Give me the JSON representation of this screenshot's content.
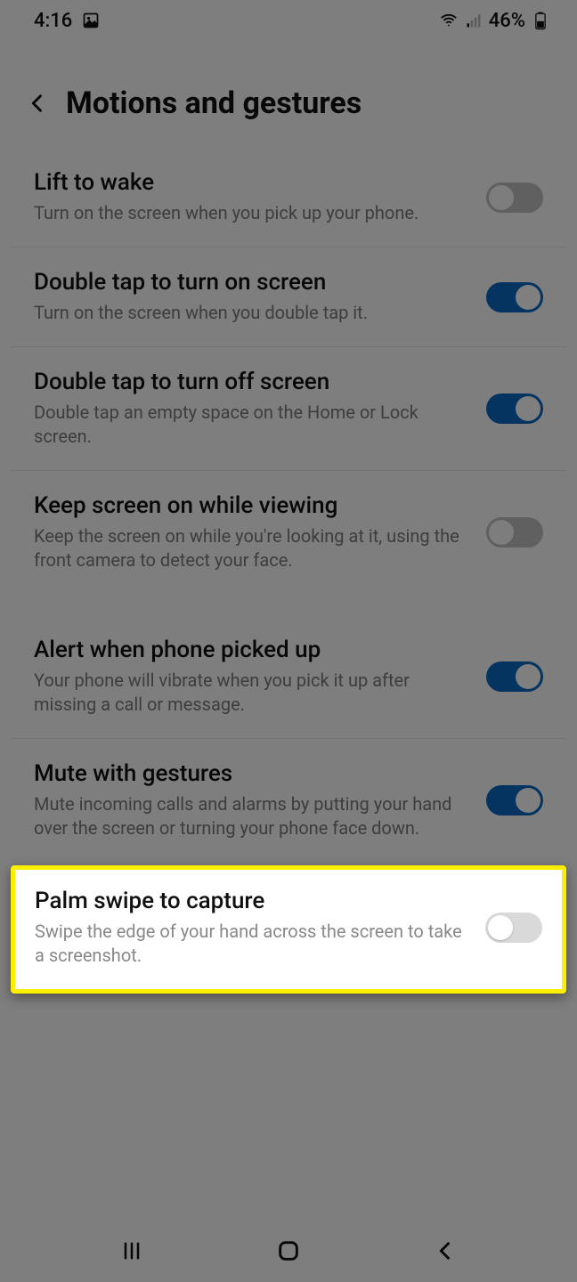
{
  "status_bar": {
    "time": "4:16",
    "battery_text": "46%"
  },
  "header": {
    "title": "Motions and gestures"
  },
  "settings_group1": [
    {
      "title": "Lift to wake",
      "desc": "Turn on the screen when you pick up your phone.",
      "on": false
    },
    {
      "title": "Double tap to turn on screen",
      "desc": "Turn on the screen when you double tap it.",
      "on": true
    },
    {
      "title": "Double tap to turn off screen",
      "desc": "Double tap an empty space on the Home or Lock screen.",
      "on": true
    },
    {
      "title": "Keep screen on while viewing",
      "desc": "Keep the screen on while you're looking at it, using the front camera to detect your face.",
      "on": false
    }
  ],
  "settings_group2": [
    {
      "title": "Alert when phone picked up",
      "desc": "Your phone will vibrate when you pick it up after missing a call or message.",
      "on": true
    },
    {
      "title": "Mute with gestures",
      "desc": "Mute incoming calls and alarms by putting your hand over the screen or turning your phone face down.",
      "on": true
    }
  ],
  "highlighted_setting": {
    "title": "Palm swipe to capture",
    "desc": "Swipe the edge of your hand across the screen to take a screenshot.",
    "on": false
  }
}
